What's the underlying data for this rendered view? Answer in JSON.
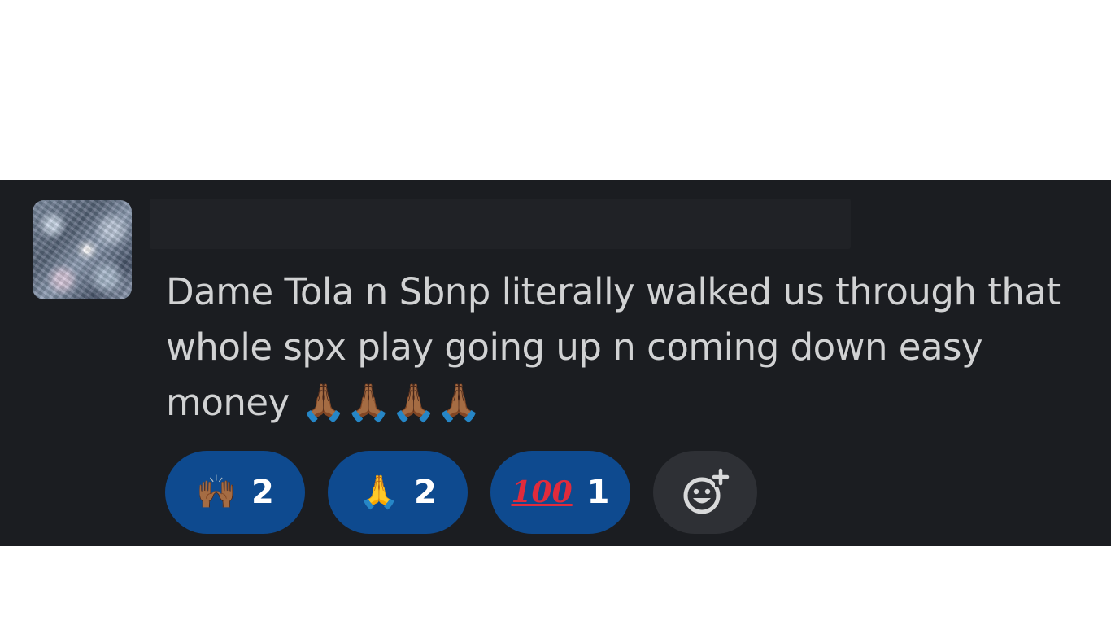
{
  "message": {
    "text": "Dame Tola n Sbnp literally walked us through that whole spx play going up n coming down easy money 🙏🏾🙏🏾🙏🏾🙏🏾"
  },
  "reactions": [
    {
      "emoji": "🙌🏾",
      "count": "2",
      "icon": "raising-hands-icon"
    },
    {
      "emoji": "🙏",
      "count": "2",
      "icon": "folded-hands-icon"
    },
    {
      "emoji": "100",
      "count": "1",
      "icon": "hundred-points-icon"
    }
  ],
  "add_reaction": {
    "icon": "add-reaction-icon"
  },
  "colors": {
    "background": "#1b1d21",
    "text": "#d1d2d3",
    "reaction_pill": "#0e4a8f",
    "add_reaction_pill": "#2e3035"
  }
}
